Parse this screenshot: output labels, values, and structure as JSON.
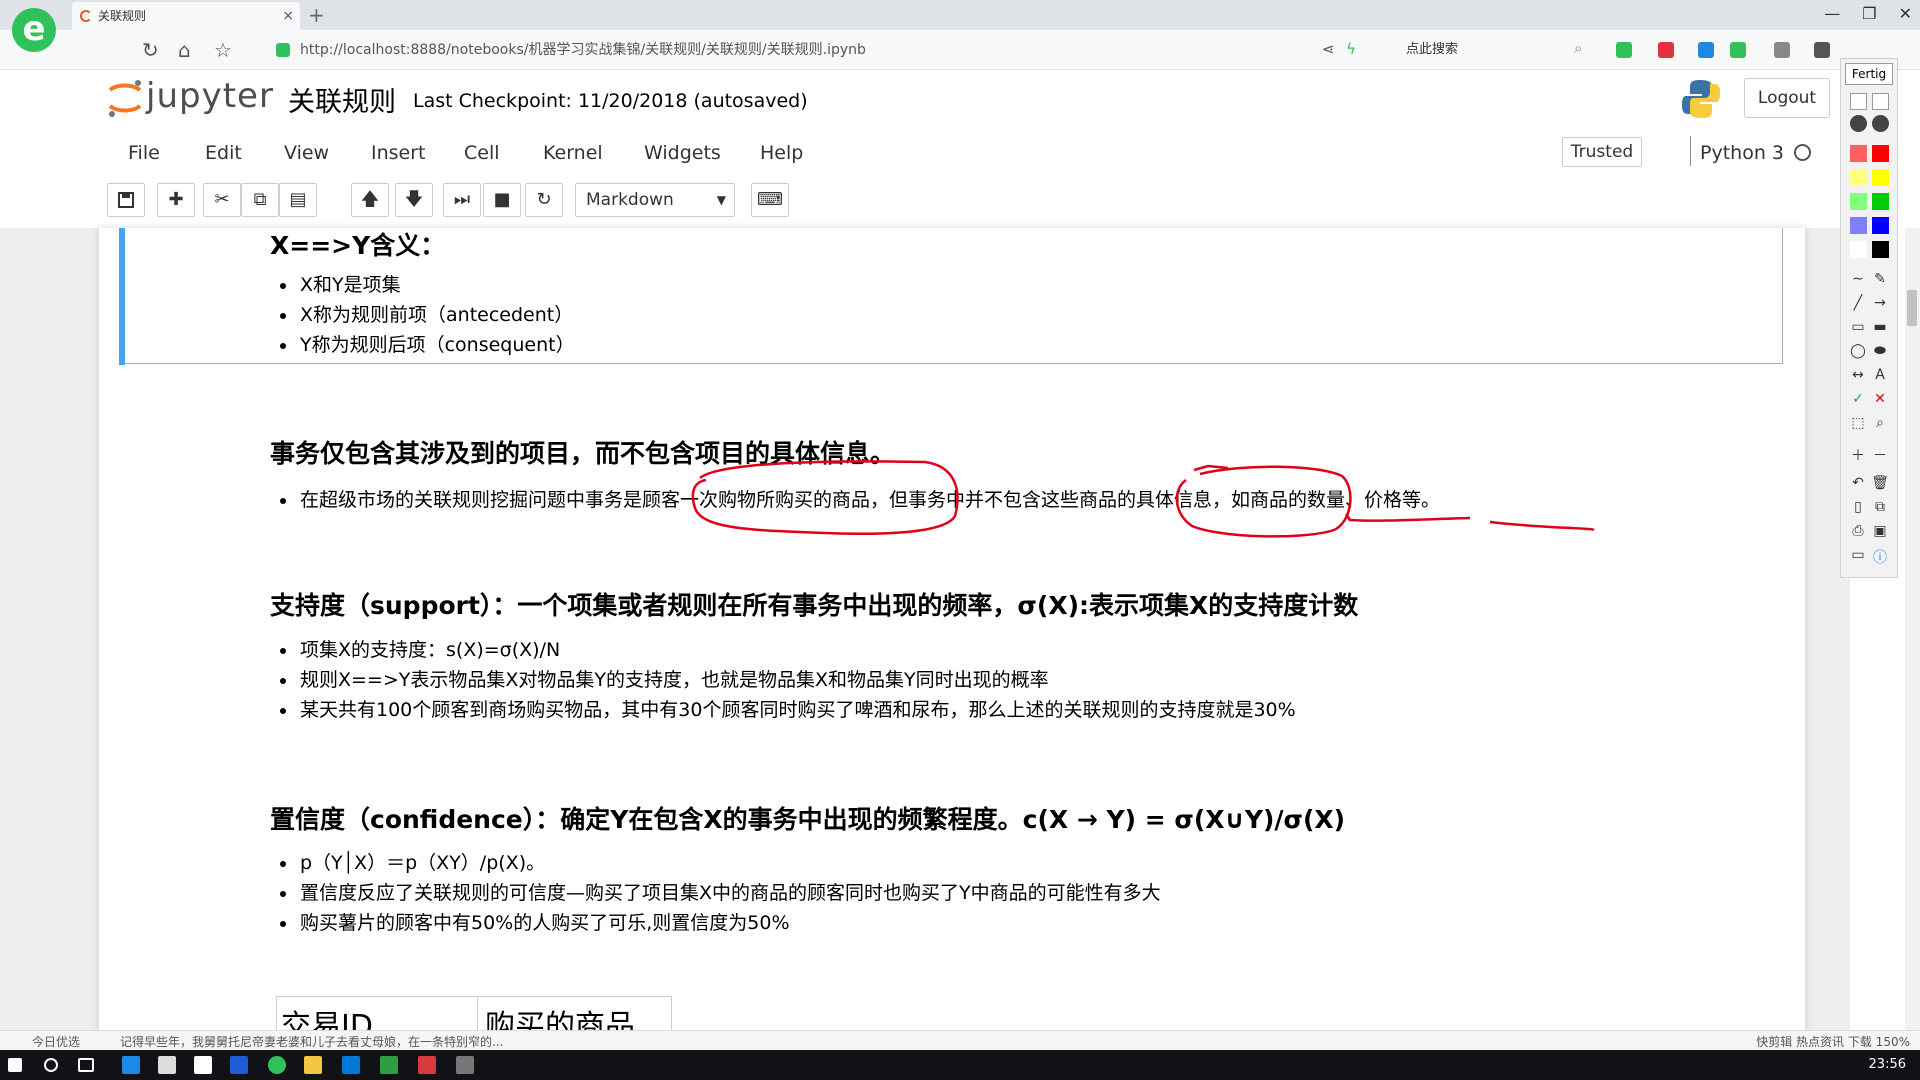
{
  "browser": {
    "tab_title": "关联规则",
    "tab_close": "×",
    "new_tab": "+",
    "url": "http://localhost:8888/notebooks/机器学习实战集锦/关联规则/关联规则/关联规则.ipynb",
    "search_placeholder": "点此搜索",
    "window_controls": [
      "—",
      "❐",
      "✕"
    ]
  },
  "jupyter": {
    "logo_text": "jupyter",
    "notebook_name": "关联规则",
    "checkpoint": "Last Checkpoint: 11/20/2018 (autosaved)",
    "logout_label": "Logout",
    "menu": [
      "File",
      "Edit",
      "View",
      "Insert",
      "Cell",
      "Kernel",
      "Widgets",
      "Help"
    ],
    "trusted_label": "Trusted",
    "kernel_name": "Python 3",
    "cell_type": "Markdown"
  },
  "cells": {
    "xy": {
      "heading": "X==>Y含义：",
      "items": [
        "X和Y是项集",
        "X称为规则前项（antecedent）",
        "Y称为规则后项（consequent）"
      ]
    },
    "transaction": {
      "heading": "事务仅包含其涉及到的项目，而不包含项目的具体信息。",
      "items": [
        "在超级市场的关联规则挖掘问题中事务是顾客一次购物所购买的商品，但事务中并不包含这些商品的具体信息，如商品的数量、价格等。"
      ]
    },
    "support": {
      "heading": "支持度（support）：一个项集或者规则在所有事务中出现的频率，σ(X):表示项集X的支持度计数",
      "items": [
        "项集X的支持度：s(X)=σ(X)/N",
        "规则X==>Y表示物品集X对物品集Y的支持度，也就是物品集X和物品集Y同时出现的概率",
        "某天共有100个顾客到商场购买物品，其中有30个顾客同时购买了啤酒和尿布，那么上述的关联规则的支持度就是30%"
      ]
    },
    "confidence": {
      "heading": "置信度（confidence）：确定Y在包含X的事务中出现的频繁程度。c(X → Y) = σ(X∪Y)/σ(X)",
      "items": [
        "p（Y│X）＝p（XY）/p(X)。",
        "置信度反应了关联规则的可信度—购买了项目集X中的商品的顾客同时也购买了Y中商品的可能性有多大",
        "购买薯片的顾客中有50%的人购买了可乐,则置信度为50%"
      ]
    },
    "table_headers": [
      "交易ID",
      "购买的商品"
    ]
  },
  "palette": {
    "title": "Fertig",
    "colors": [
      "#ff6060",
      "#ff0000",
      "#ffff80",
      "#ffff00",
      "#80ff80",
      "#00cc00",
      "#8080ff",
      "#0000ff",
      "#ffffff",
      "#000000"
    ],
    "annotation_color": "#e0001a"
  },
  "status": {
    "left": "今日优选",
    "news": "记得早些年，我舅舅托尼帝妻老婆和儿子去看丈母娘，在一条特别窄的...",
    "right": "快剪辑   热点资讯   下载   150%",
    "clock": "23:56"
  }
}
